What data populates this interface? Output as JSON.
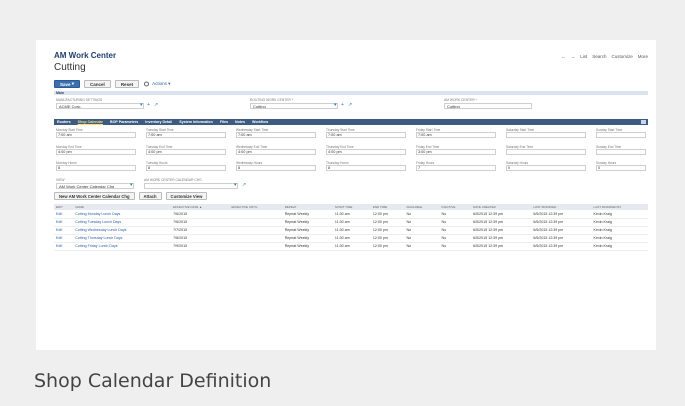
{
  "app": {
    "title": "AM Work Center",
    "record": "Cutting"
  },
  "topnav": {
    "prev": "←",
    "next": "→",
    "items": [
      "List",
      "Search",
      "Customize",
      "More"
    ]
  },
  "buttons": {
    "save": "Save",
    "save_arrow": "▾",
    "cancel": "Cancel",
    "reset": "Reset",
    "actions": "Actions ▾"
  },
  "section": {
    "main": "Main"
  },
  "fields": {
    "location_settings": {
      "label": "Manufacturing Settings",
      "value": "ACME Corp."
    },
    "routing_center": {
      "label": "Routing Work Center *",
      "value": "Cutting"
    },
    "work_center": {
      "label": "AM Work Center *",
      "value": "Cutting"
    }
  },
  "tabs": [
    "Routers",
    "Shop Calendar",
    "BOP Parameters",
    "Inventory Detail",
    "System Information",
    "Files",
    "Notes",
    "Workflow"
  ],
  "active_tab": "Shop Calendar",
  "days": {
    "labels": {
      "start": [
        "Monday Start Time",
        "Tuesday Start Time",
        "Wednesday Start Time",
        "Thursday Start Time",
        "Friday Start Time",
        "Saturday Start Time",
        "Sunday Start Time"
      ],
      "end": [
        "Monday End Time",
        "Tuesday End Time",
        "Wednesday End Time",
        "Thursday End Time",
        "Friday End Time",
        "Saturday End Time",
        "Sunday End Time"
      ],
      "hours": [
        "Monday Hours",
        "Tuesday Hours",
        "Wednesday Hours",
        "Thursday Hours",
        "Friday Hours",
        "Saturday Hours",
        "Sunday Hours"
      ]
    },
    "start": [
      "7:00 am",
      "7:00 am",
      "7:00 am",
      "7:00 am",
      "7:00 am",
      "",
      ""
    ],
    "end": [
      "4:00 pm",
      "4:00 pm",
      "4:00 pm",
      "4:00 pm",
      "3:00 pm",
      "",
      ""
    ],
    "hours": [
      "8",
      "8",
      "8",
      "8",
      "7",
      "0",
      "0"
    ]
  },
  "view": {
    "label": "View",
    "value": "AM Work Center Calendar Chg",
    "cal_label": "AM Work Center Calendar Chg"
  },
  "sub_buttons": {
    "new": "New AM Work Center Calendar Chg",
    "attach": "Attach",
    "customize": "Customize View"
  },
  "table": {
    "headers": [
      "Edit",
      "Name",
      "Effective Date ▲",
      "Effective Until",
      "Repeat",
      "Start Time",
      "End Time",
      "Available",
      "Inactive",
      "Date Created",
      "Last Modified",
      "Last Modified By"
    ],
    "rows": [
      [
        "Edit",
        "Cutting Monday Lunch Days",
        "7/6/2015",
        "",
        "Repeat Weekly",
        "11:30 am",
        "12:00 pm",
        "No",
        "No",
        "6/5/2015 12:39 pm",
        "6/5/2015 12:39 pm",
        "Kevin Kraig"
      ],
      [
        "Edit",
        "Cutting Tuesday Lunch Days",
        "7/6/2015",
        "",
        "Repeat Weekly",
        "11:30 am",
        "12:00 pm",
        "No",
        "No",
        "6/5/2015 12:39 pm",
        "6/5/2015 12:39 pm",
        "Kevin Kraig"
      ],
      [
        "Edit",
        "Cutting Wednesday Lunch Days",
        "7/7/2015",
        "",
        "Repeat Weekly",
        "11:30 am",
        "12:00 pm",
        "No",
        "No",
        "6/5/2015 12:39 pm",
        "6/5/2015 12:39 pm",
        "Kevin Kraig"
      ],
      [
        "Edit",
        "Cutting Thursday Lunch Days",
        "7/8/2015",
        "",
        "Repeat Weekly",
        "11:30 am",
        "12:00 pm",
        "No",
        "No",
        "6/5/2015 12:39 pm",
        "6/5/2015 12:39 pm",
        "Kevin Kraig"
      ],
      [
        "Edit",
        "Cutting Friday Lunch Days",
        "7/9/2015",
        "",
        "Repeat Weekly",
        "11:30 am",
        "12:00 pm",
        "No",
        "No",
        "6/5/2015 12:39 pm",
        "6/5/2015 12:39 pm",
        "Kevin Kraig"
      ]
    ]
  },
  "caption": "Shop Calendar Definition"
}
